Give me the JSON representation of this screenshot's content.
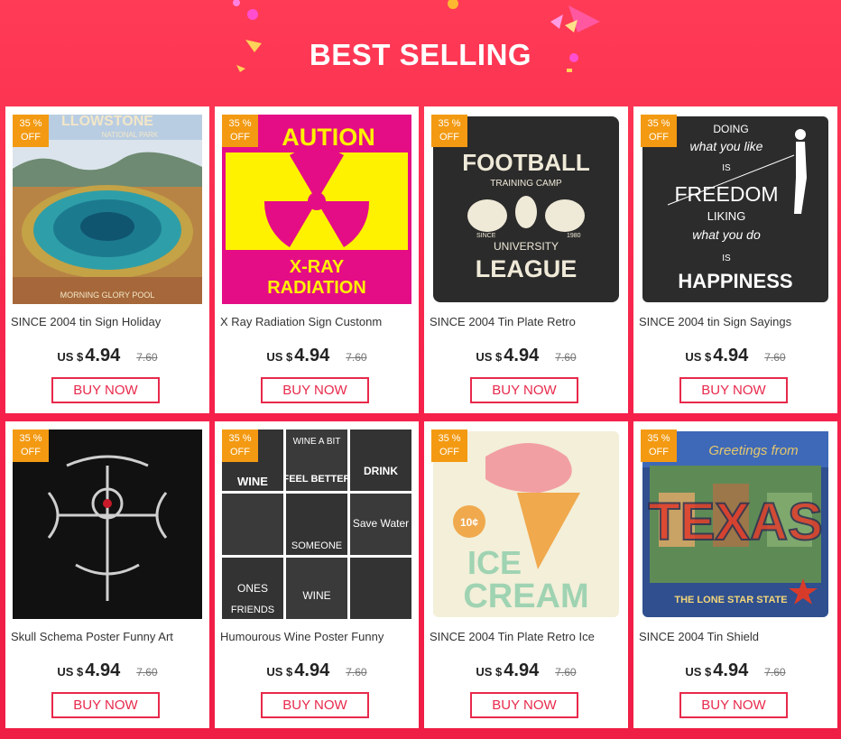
{
  "header": {
    "title": "BEST SELLING"
  },
  "products": [
    {
      "name": "SINCE 2004 tin Sign Holiday",
      "badge_pct": "35 %",
      "badge_off": "OFF",
      "currency": "US $",
      "price": "4.94",
      "old_price": "7.60",
      "buy_label": "BUY NOW",
      "image_text": [
        "LLOWSTONE",
        "NATIONAL PARK",
        "MORNING GLORY POOL"
      ]
    },
    {
      "name": "X Ray Radiation Sign Custonm",
      "badge_pct": "35 %",
      "badge_off": "OFF",
      "currency": "US $",
      "price": "4.94",
      "old_price": "7.60",
      "buy_label": "BUY NOW",
      "image_text": [
        "AUTION",
        "X-RAY",
        "RADIATION"
      ]
    },
    {
      "name": "SINCE 2004 Tin Plate Retro",
      "badge_pct": "35 %",
      "badge_off": "OFF",
      "currency": "US $",
      "price": "4.94",
      "old_price": "7.60",
      "buy_label": "BUY NOW",
      "image_text": [
        "FOOTBALL",
        "TRAINING CAMP",
        "SINCE",
        "1980",
        "UNIVERSITY",
        "LEAGUE"
      ]
    },
    {
      "name": "SINCE 2004 tin Sign Sayings",
      "badge_pct": "35 %",
      "badge_off": "OFF",
      "currency": "US $",
      "price": "4.94",
      "old_price": "7.60",
      "buy_label": "BUY NOW",
      "image_text": [
        "DOING",
        "what you like",
        "IS",
        "FREEDOM",
        "LIKING",
        "what you do",
        "IS",
        "HAPPINESS"
      ]
    },
    {
      "name": "Skull Schema Poster Funny Art",
      "badge_pct": "35 %",
      "badge_off": "OFF",
      "currency": "US $",
      "price": "4.94",
      "old_price": "7.60",
      "buy_label": "BUY NOW",
      "image_text": []
    },
    {
      "name": "Humourous Wine Poster Funny",
      "badge_pct": "35 %",
      "badge_off": "OFF",
      "currency": "US $",
      "price": "4.94",
      "old_price": "7.60",
      "buy_label": "BUY NOW",
      "image_text": [
        "WINE A BIT",
        "FEEL BETTER",
        "DRINK",
        "WINE",
        "SOMEONE",
        "Save Water",
        "ONES",
        "FRIENDS",
        "WINE"
      ]
    },
    {
      "name": "SINCE 2004 Tin Plate Retro Ice",
      "badge_pct": "35 %",
      "badge_off": "OFF",
      "currency": "US $",
      "price": "4.94",
      "old_price": "7.60",
      "buy_label": "BUY NOW",
      "image_text": [
        "10¢",
        "ICE",
        "CREAM"
      ]
    },
    {
      "name": "SINCE 2004 Tin Shield",
      "badge_pct": "35 %",
      "badge_off": "OFF",
      "currency": "US $",
      "price": "4.94",
      "old_price": "7.60",
      "buy_label": "BUY NOW",
      "image_text": [
        "Greetings from",
        "TEXAS",
        "THE LONE STAR STATE"
      ]
    }
  ],
  "colors": {
    "accent": "#e8294b",
    "badge": "#f39a12",
    "background": "#f5214a"
  }
}
